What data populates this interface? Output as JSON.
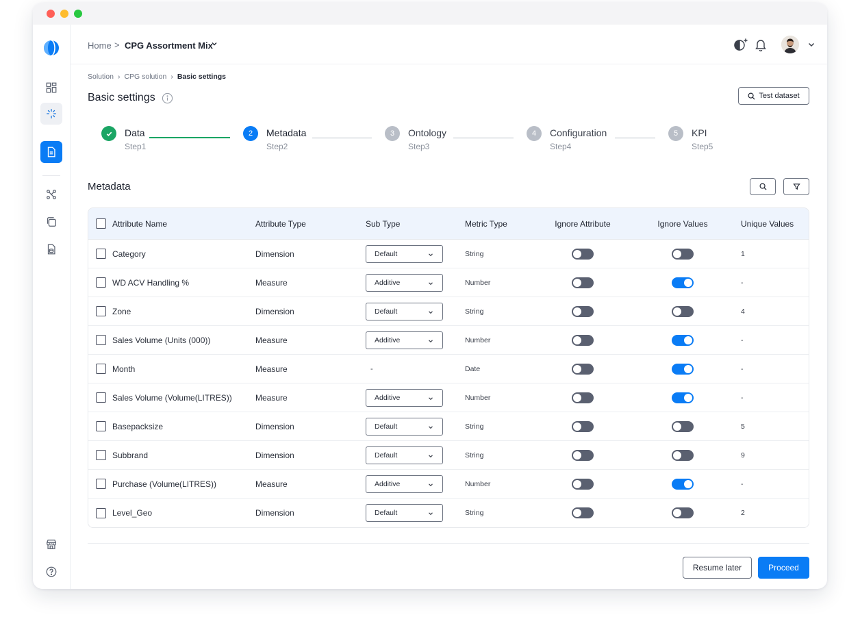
{
  "topbar": {
    "home": "Home",
    "separator": ">",
    "current": "CPG Assortment Mix",
    "icons": [
      "theme-toggle-icon",
      "bell-icon",
      "avatar",
      "chevron-down-icon"
    ]
  },
  "breadcrumb": {
    "items": [
      "Solution",
      "CPG solution",
      "Basic settings"
    ]
  },
  "page": {
    "title": "Basic settings",
    "test_dataset": "Test dataset"
  },
  "stepper": {
    "steps": [
      {
        "title": "Data",
        "sub": "Step1",
        "status": "done",
        "number": ""
      },
      {
        "title": "Metadata",
        "sub": "Step2",
        "status": "active",
        "number": "2"
      },
      {
        "title": "Ontology",
        "sub": "Step3",
        "status": "pending",
        "number": "3"
      },
      {
        "title": "Configuration",
        "sub": "Step4",
        "status": "pending",
        "number": "4"
      },
      {
        "title": "KPI",
        "sub": "Step5",
        "status": "pending",
        "number": "5"
      }
    ]
  },
  "metadata": {
    "title": "Metadata",
    "columns": [
      "Attribute Name",
      "Attribute Type",
      "Sub Type",
      "Metric Type",
      "Ignore Attribute",
      "Ignore Values",
      "Unique Values"
    ],
    "rows": [
      {
        "name": "Category",
        "type": "Dimension",
        "sub": "Default",
        "metric": "String",
        "ignore_attr": false,
        "ignore_val": false,
        "unique": "1"
      },
      {
        "name": "WD ACV Handling %",
        "type": "Measure",
        "sub": "Additive",
        "metric": "Number",
        "ignore_attr": false,
        "ignore_val": true,
        "unique": "-"
      },
      {
        "name": "Zone",
        "type": "Dimension",
        "sub": "Default",
        "metric": "String",
        "ignore_attr": false,
        "ignore_val": false,
        "unique": "4"
      },
      {
        "name": "Sales Volume (Units (000))",
        "type": "Measure",
        "sub": "Additive",
        "metric": "Number",
        "ignore_attr": false,
        "ignore_val": true,
        "unique": "-"
      },
      {
        "name": "Month",
        "type": "Measure",
        "sub": "-",
        "metric": "Date",
        "ignore_attr": false,
        "ignore_val": true,
        "unique": "-"
      },
      {
        "name": "Sales Volume (Volume(LITRES))",
        "type": "Measure",
        "sub": "Additive",
        "metric": "Number",
        "ignore_attr": false,
        "ignore_val": true,
        "unique": "-"
      },
      {
        "name": "Basepacksize",
        "type": "Dimension",
        "sub": "Default",
        "metric": "String",
        "ignore_attr": false,
        "ignore_val": false,
        "unique": "5"
      },
      {
        "name": "Subbrand",
        "type": "Dimension",
        "sub": "Default",
        "metric": "String",
        "ignore_attr": false,
        "ignore_val": false,
        "unique": "9"
      },
      {
        "name": "Purchase (Volume(LITRES))",
        "type": "Measure",
        "sub": "Additive",
        "metric": "Number",
        "ignore_attr": false,
        "ignore_val": true,
        "unique": "-"
      },
      {
        "name": "Level_Geo",
        "type": "Dimension",
        "sub": "Default",
        "metric": "String",
        "ignore_attr": false,
        "ignore_val": false,
        "unique": "2"
      }
    ]
  },
  "footer": {
    "resume": "Resume later",
    "proceed": "Proceed"
  },
  "colors": {
    "accent": "#0a7cf5",
    "success": "#1aa564",
    "toggle_off": "#5a6070"
  }
}
